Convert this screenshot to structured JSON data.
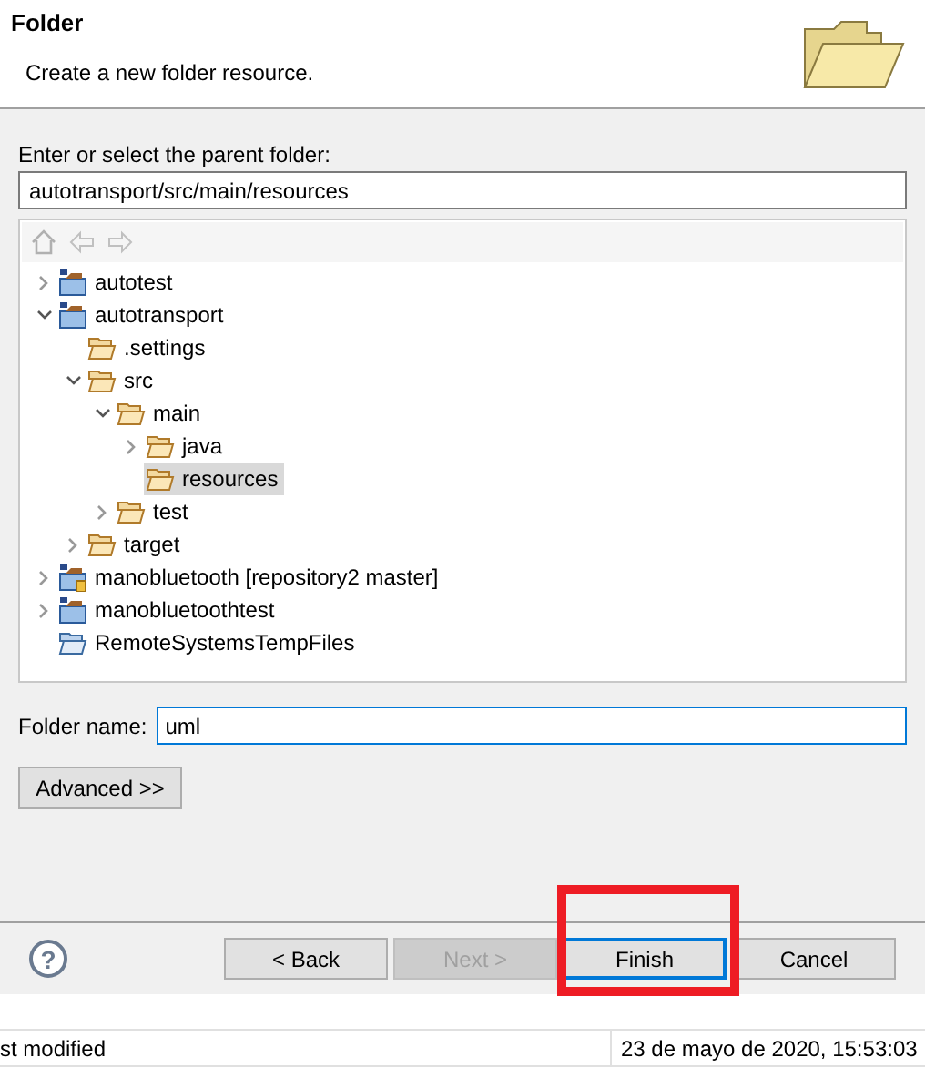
{
  "header": {
    "title": "Folder",
    "description": "Create a new folder resource."
  },
  "parent_folder": {
    "label": "Enter or select the parent folder:",
    "value": "autotransport/src/main/resources"
  },
  "tree": [
    {
      "label": "autotest",
      "kind": "project",
      "expanded": false,
      "selected": false
    },
    {
      "label": "autotransport",
      "kind": "project",
      "expanded": true,
      "selected": false,
      "children": [
        {
          "label": ".settings",
          "kind": "folder",
          "selected": false
        },
        {
          "label": "src",
          "kind": "folder",
          "expanded": true,
          "selected": false,
          "children": [
            {
              "label": "main",
              "kind": "folder",
              "expanded": true,
              "selected": false,
              "children": [
                {
                  "label": "java",
                  "kind": "folder",
                  "expanded": false,
                  "selected": false
                },
                {
                  "label": "resources",
                  "kind": "folder",
                  "selected": true
                }
              ]
            },
            {
              "label": "test",
              "kind": "folder",
              "expanded": false,
              "selected": false
            }
          ]
        },
        {
          "label": "target",
          "kind": "folder",
          "expanded": false,
          "selected": false
        }
      ]
    },
    {
      "label": "manobluetooth [repository2 master]",
      "kind": "shared-project",
      "expanded": false,
      "selected": false
    },
    {
      "label": "manobluetoothtest",
      "kind": "project",
      "expanded": false,
      "selected": false
    },
    {
      "label": "RemoteSystemsTempFiles",
      "kind": "special-folder",
      "selected": false
    }
  ],
  "folder_name": {
    "label": "Folder name:",
    "value": "uml"
  },
  "advanced_button": "Advanced >>",
  "help_button": "?",
  "buttons": [
    {
      "label": "< Back",
      "disabled": false,
      "default": false,
      "annotated": false
    },
    {
      "label": "Next >",
      "disabled": true,
      "default": false,
      "annotated": false
    },
    {
      "label": "Finish",
      "disabled": false,
      "default": true,
      "annotated": true
    },
    {
      "label": "Cancel",
      "disabled": false,
      "default": false,
      "annotated": false
    }
  ],
  "background_table": {
    "rows": [
      {
        "property": "st modified",
        "value": "23 de mayo de 2020, 15:53:03"
      }
    ]
  }
}
